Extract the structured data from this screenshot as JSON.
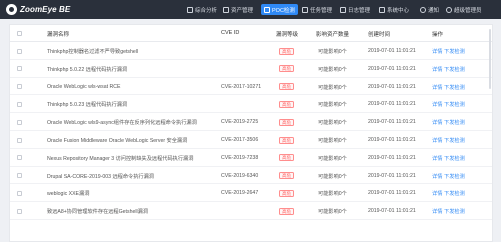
{
  "app": {
    "title": "ZoomEye BE"
  },
  "nav": [
    {
      "label": "综合分析",
      "icon": "grid-icon"
    },
    {
      "label": "资产管理",
      "icon": "grid-icon"
    },
    {
      "label": "POC检测",
      "icon": "document-icon",
      "active": true
    },
    {
      "label": "任务管理",
      "icon": "list-icon"
    },
    {
      "label": "日志管理",
      "icon": "calendar-icon"
    },
    {
      "label": "系统中心",
      "icon": "monitor-icon"
    },
    {
      "label": "通知",
      "icon": "bell-icon"
    },
    {
      "label": "超级管理员",
      "icon": "user-icon"
    }
  ],
  "table": {
    "headers": [
      "漏洞名称",
      "CVE ID",
      "漏洞等级",
      "影响资产数量",
      "创建时间",
      "操作"
    ],
    "rows": [
      {
        "name": "Thinkphp控制器名过滤不严导致getshell",
        "cve": "",
        "level": "高危",
        "impact": "可能影响0个",
        "time": "2019-07-01 11:01:21",
        "a1": "详情",
        "a2": "下发检测"
      },
      {
        "name": "Thinkphp 5.0.22 远程代码执行漏洞",
        "cve": "",
        "level": "高危",
        "impact": "可能影响0个",
        "time": "2019-07-01 11:01:21",
        "a1": "详情",
        "a2": "下发检测"
      },
      {
        "name": "Oracle WebLogic wls-wsat RCE",
        "cve": "CVE-2017-10271",
        "level": "高危",
        "impact": "可能影响0个",
        "time": "2019-07-01 11:01:21",
        "a1": "详情",
        "a2": "下发检测"
      },
      {
        "name": "Thinkphp 5.0.23 远程代码执行漏洞",
        "cve": "",
        "level": "高危",
        "impact": "可能影响0个",
        "time": "2019-07-01 11:01:21",
        "a1": "详情",
        "a2": "下发检测"
      },
      {
        "name": "Oracle WebLogic wls9-async组件存在反序列化远程命令执行漏洞",
        "cve": "CVE-2019-2725",
        "level": "高危",
        "impact": "可能影响0个",
        "time": "2019-07-01 11:01:21",
        "a1": "详情",
        "a2": "下发检测"
      },
      {
        "name": "Oracle Fusion Middleware Oracle WebLogic Server 安全漏洞",
        "cve": "CVE-2017-3506",
        "level": "高危",
        "impact": "可能影响0个",
        "time": "2019-07-01 11:01:21",
        "a1": "详情",
        "a2": "下发检测"
      },
      {
        "name": "Nexus Repository Manager 3 访问控制缺失及远程代码执行漏洞",
        "cve": "CVE-2019-7238",
        "level": "高危",
        "impact": "可能影响0个",
        "time": "2019-07-01 11:01:21",
        "a1": "详情",
        "a2": "下发检测"
      },
      {
        "name": "Drupal SA-CORE-2019-003 远程命令执行漏洞",
        "cve": "CVE-2019-6340",
        "level": "高危",
        "impact": "可能影响0个",
        "time": "2019-07-01 11:01:21",
        "a1": "详情",
        "a2": "下发检测"
      },
      {
        "name": "weblogic XXE漏洞",
        "cve": "CVE-2019-2647",
        "level": "高危",
        "impact": "可能影响0个",
        "time": "2019-07-01 11:01:21",
        "a1": "详情",
        "a2": "下发检测"
      },
      {
        "name": "致远A8+协同管理软件存在远程Getshell漏洞",
        "cve": "",
        "level": "高危",
        "impact": "可能影响0个",
        "time": "2019-07-01 11:01:21",
        "a1": "详情",
        "a2": "下发检测"
      }
    ]
  }
}
